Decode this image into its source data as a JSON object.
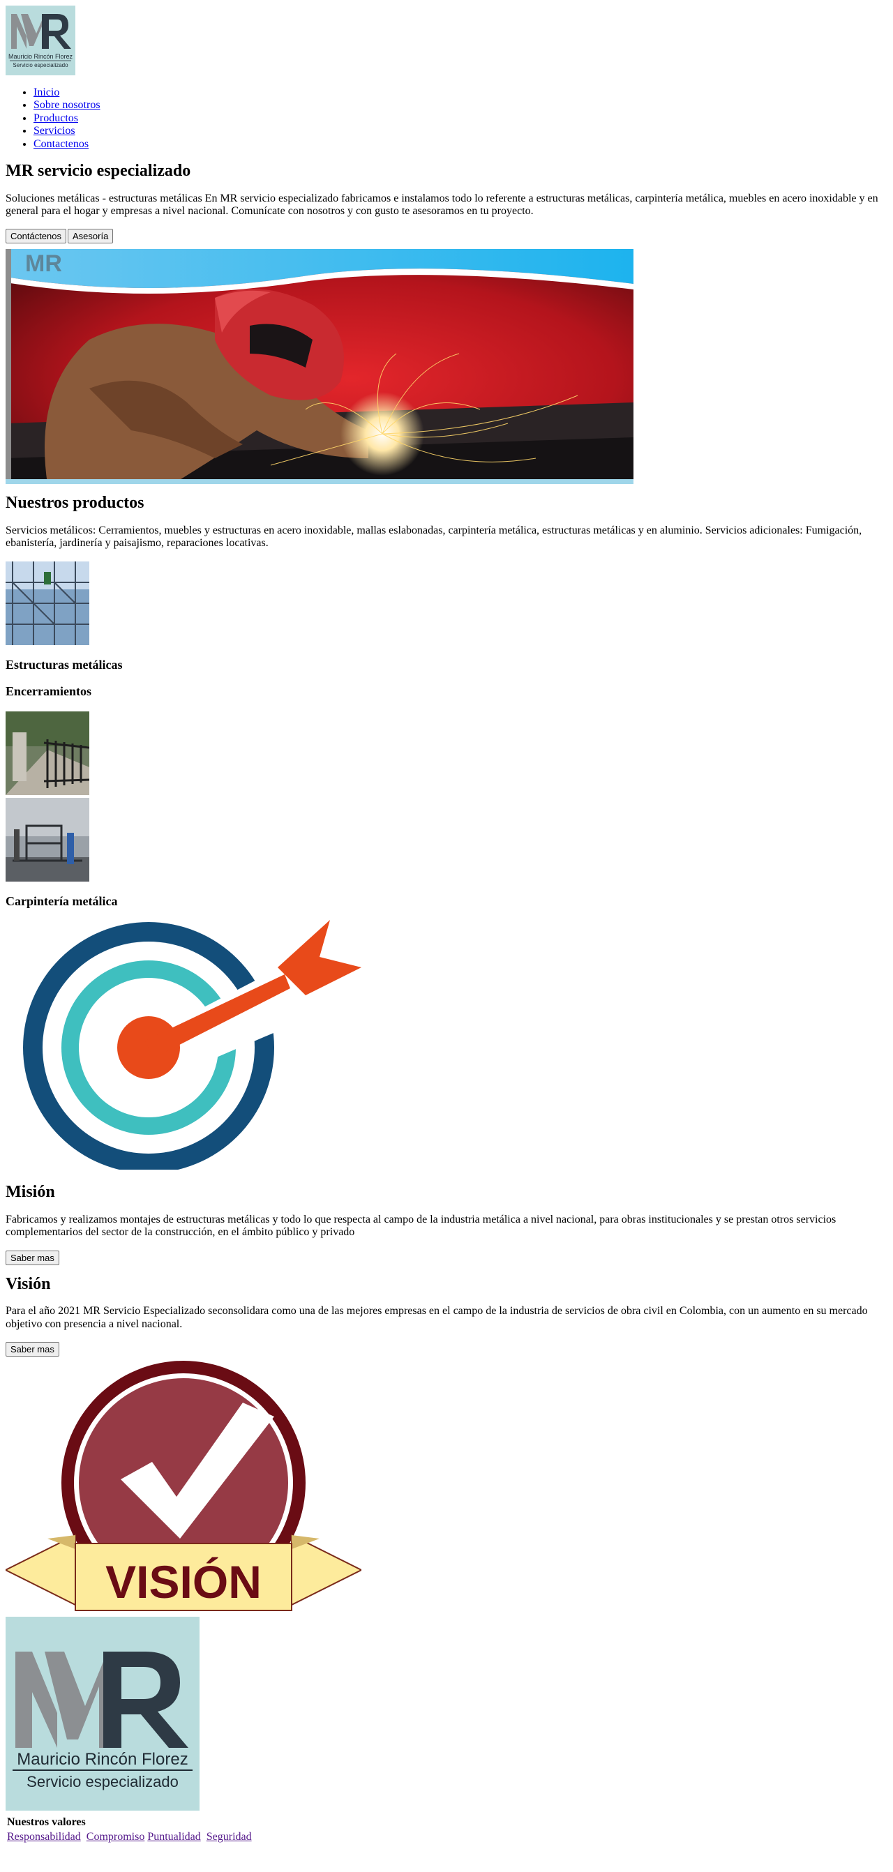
{
  "header": {
    "logo": {
      "monogram": "MR",
      "name": "Mauricio Rincón Florez",
      "tagline": "Servicio especializado"
    }
  },
  "nav": {
    "items": [
      {
        "label": "Inicio"
      },
      {
        "label": "Sobre nosotros"
      },
      {
        "label": "Productos"
      },
      {
        "label": "Servicios"
      },
      {
        "label": "Contactenos"
      }
    ]
  },
  "hero": {
    "title": "MR servicio especializado",
    "text": "Soluciones metálicas - estructuras metálicas En MR servicio especializado fabricamos e instalamos todo lo referente a estructuras metálicas, carpintería metálica, muebles en acero inoxidable y en general para el hogar y empresas a nivel nacional. Comunícate con nosotros y con gusto te asesoramos en tu proyecto.",
    "buttons": {
      "contact": "Contáctenos",
      "advice": "Asesoría"
    },
    "banner_logo_text": "MR"
  },
  "products": {
    "title": "Nuestros productos",
    "text": "Servicios metálicos: Cerramientos, muebles y estructuras en acero inoxidable, mallas eslabonadas, carpintería metálica, estructuras metálicas y en aluminio. Servicios adicionales: Fumigación, ebanistería, jardinería y paisajismo, reparaciones locativas.",
    "item1": "Estructuras metálicas",
    "item2": "Encerramientos",
    "item3": "Carpintería metálica"
  },
  "mission": {
    "title": "Misión",
    "text": "Fabricamos y realizamos montajes de estructuras metálicas y todo lo que respecta al campo de la industria metálica a nivel nacional, para obras institucionales y se prestan otros servicios complementarios del sector de la construcción, en el ámbito público y privado",
    "button": "Saber mas"
  },
  "vision": {
    "title": "Visión",
    "text": "Para el año 2021 MR Servicio Especializado seconsolidara como una de las mejores empresas en el campo de la industria de servicios de obra civil en Colombia, con un aumento en su mercado objetivo con presencia a nivel nacional.",
    "button": "Saber mas",
    "badge_text": "VISIÓN"
  },
  "values": {
    "title": "Nuestros valores",
    "links": [
      {
        "label": "Responsabilidad"
      },
      {
        "label": "Compromiso"
      },
      {
        "label": "Puntualidad"
      },
      {
        "label": "Seguridad"
      }
    ]
  },
  "colors": {
    "logo_bg": "#b9dcdd",
    "target_dark": "#134e7a",
    "target_teal": "#3fbfbf",
    "arrow_orange": "#e84a1a",
    "vision_maroon": "#6a0c14",
    "vision_red": "#963a45",
    "vision_ribbon": "#fdeb9c"
  }
}
